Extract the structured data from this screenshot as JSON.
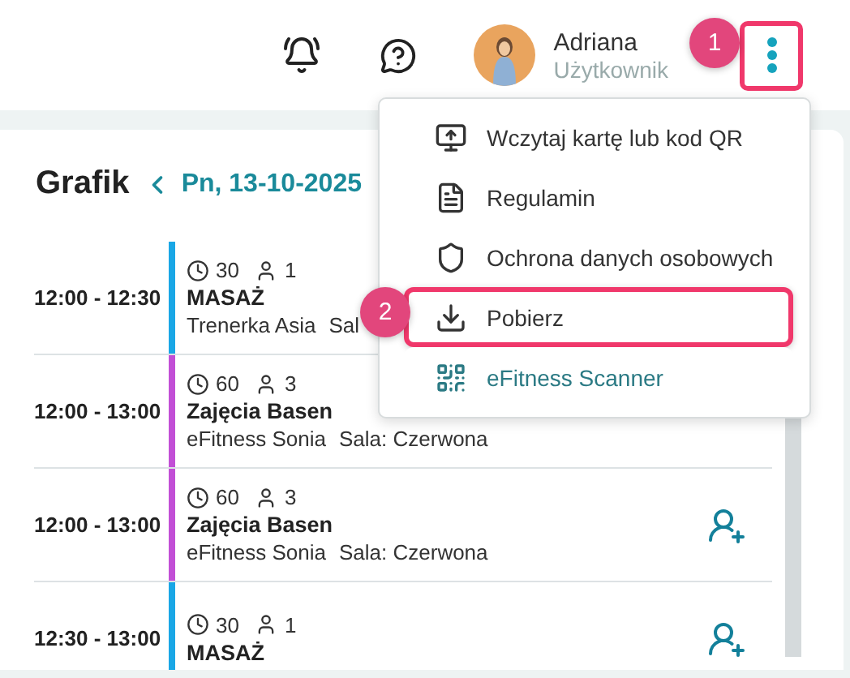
{
  "header": {
    "user": {
      "name": "Adriana",
      "role": "Użytkownik"
    },
    "menu_button": {
      "highlighted": true
    }
  },
  "schedule": {
    "title": "Grafik",
    "date": "Pn, 13-10-2025",
    "rows": [
      {
        "time": "12:00 - 12:30",
        "color": "#1aa7e6",
        "duration": "30",
        "participants": "1",
        "name": "MASAŻ",
        "trainer": "Trenerka Asia",
        "room": "Sal",
        "action_icon": false
      },
      {
        "time": "12:00 - 13:00",
        "color": "#c24fd6",
        "duration": "60",
        "participants": "3",
        "name": "Zajęcia Basen",
        "trainer": "eFitness Sonia",
        "room": "Sala: Czerwona",
        "action_icon": false
      },
      {
        "time": "12:00 - 13:00",
        "color": "#c24fd6",
        "duration": "60",
        "participants": "3",
        "name": "Zajęcia Basen",
        "trainer": "eFitness Sonia",
        "room": "Sala: Czerwona",
        "action_icon": true
      },
      {
        "time": "12:30 - 13:00",
        "color": "#1aa7e6",
        "duration": "30",
        "participants": "1",
        "name": "MASAŻ",
        "action_icon": true
      }
    ]
  },
  "menu": {
    "items": [
      {
        "label": "Wczytaj kartę lub kod QR",
        "accent": false,
        "highlighted": false
      },
      {
        "label": "Regulamin",
        "accent": false,
        "highlighted": false
      },
      {
        "label": "Ochrona danych osobowych",
        "accent": false,
        "highlighted": false
      },
      {
        "label": "Pobierz",
        "accent": false,
        "highlighted": true
      },
      {
        "label": "eFitness Scanner",
        "accent": true,
        "highlighted": false
      }
    ]
  },
  "annotations": [
    {
      "label": "1"
    },
    {
      "label": "2"
    }
  ]
}
